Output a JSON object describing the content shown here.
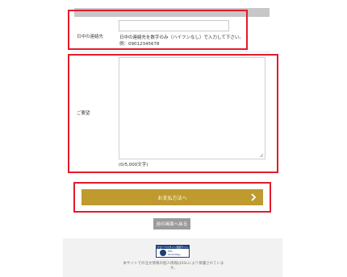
{
  "phone_row": {
    "label": "日中の連絡先",
    "help_line1": "日中の連絡先を数字のみ（ハイフンなし）で入力して下さい。",
    "help_line2": "例：09012345678"
  },
  "request_row": {
    "label": "ご要望",
    "counter": "(0/5,000文字)"
  },
  "actions": {
    "pay_label": "お支払方法へ",
    "back_label": "前の画面へ戻る"
  },
  "footer": {
    "seal_top": "グローバルサイン認証サイト",
    "seal_line1": "SSL",
    "seal_line2": "GlobalSign",
    "note": "本サイトでの注文情報の個人情報はSSLにより保護されています。"
  },
  "colors": {
    "accent": "#bf9a2e",
    "highlight": "#e21b2b",
    "back_button": "#9b9b9b"
  }
}
